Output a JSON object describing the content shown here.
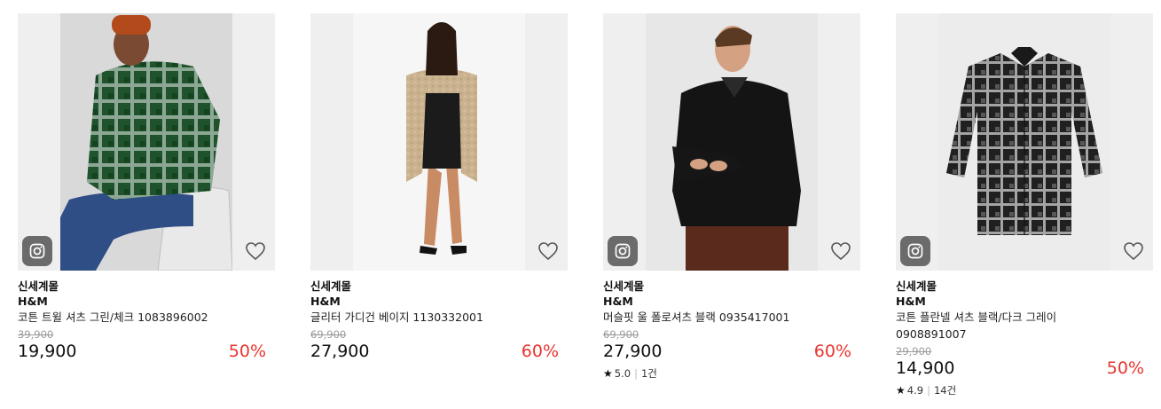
{
  "products": [
    {
      "seller": "신세계몰",
      "brand": "H&M",
      "name": "코튼 트윌 셔츠 그린/체크 1083896002",
      "original_price": "39,900",
      "price": "19,900",
      "discount": "50%",
      "rating": null,
      "review_count": null,
      "image_desc": "green-plaid-shirt-model",
      "has_insta_badge": true
    },
    {
      "seller": "신세계몰",
      "brand": "H&M",
      "name": "글리터 가디건 베이지 1130332001",
      "original_price": "69,900",
      "price": "27,900",
      "discount": "60%",
      "rating": null,
      "review_count": null,
      "image_desc": "beige-glitter-cardigan-model",
      "has_insta_badge": false
    },
    {
      "seller": "신세계몰",
      "brand": "H&M",
      "name": "머슬핏 울 폴로셔츠 블랙 0935417001",
      "original_price": "69,900",
      "price": "27,900",
      "discount": "60%",
      "rating": "5.0",
      "review_count": "1건",
      "image_desc": "black-polo-shirt-model",
      "has_insta_badge": true
    },
    {
      "seller": "신세계몰",
      "brand": "H&M",
      "name": "코튼 플란넬 셔츠 블랙/다크 그레이 0908891007",
      "original_price": "29,900",
      "price": "14,900",
      "discount": "50%",
      "rating": "4.9",
      "review_count": "14건",
      "image_desc": "black-flannel-shirt-flatlay",
      "has_insta_badge": true
    }
  ],
  "icons": {
    "instagram": "instagram-icon",
    "wishlist": "heart-icon",
    "rating": "star-icon"
  },
  "colors": {
    "discount": "#e8342f",
    "badge_bg": "#6b6b6b",
    "image_bg": "#efefef"
  }
}
